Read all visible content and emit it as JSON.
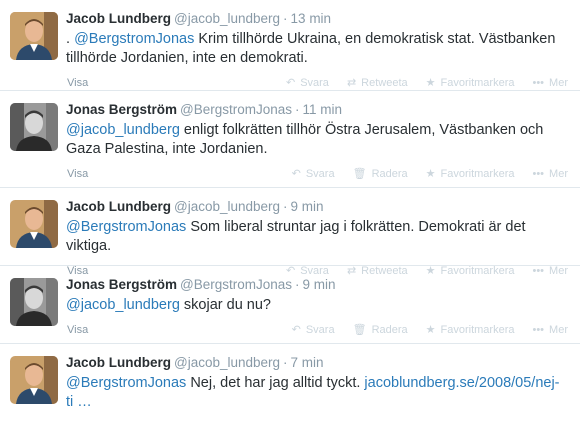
{
  "tweets": [
    {
      "avatar": "avatar-jacob",
      "fullname": "Jacob Lundberg",
      "username": "@jacob_lundberg",
      "separator": "·",
      "time": "13 min",
      "prefix": ". ",
      "mention": "@BergstromJonas",
      "text": " Krim tillhörde Ukraina, en demokratisk stat. Västbanken tillhörde Jordanien, inte en demokrati.",
      "expand": "Visa",
      "actions": [
        {
          "icon": "reply-icon",
          "glyph": "↶",
          "label": "Svara"
        },
        {
          "icon": "retweet-icon",
          "glyph": "⇄",
          "label": "Retweeta"
        },
        {
          "icon": "star-icon",
          "glyph": "★",
          "label": "Favoritmarkera"
        },
        {
          "icon": "more-icon",
          "glyph": "•••",
          "label": "Mer"
        }
      ]
    },
    {
      "avatar": "avatar-jonas",
      "fullname": "Jonas Bergström",
      "username": "@BergstromJonas",
      "separator": "·",
      "time": "11 min",
      "prefix": "",
      "mention": "@jacob_lundberg",
      "text": " enligt folkrätten tillhör Östra Jerusalem, Västbanken och Gaza Palestina, inte Jordanien.",
      "expand": "Visa",
      "actions": [
        {
          "icon": "reply-icon",
          "glyph": "↶",
          "label": "Svara"
        },
        {
          "icon": "delete-icon",
          "glyph": "🗑",
          "label": "Radera"
        },
        {
          "icon": "star-icon",
          "glyph": "★",
          "label": "Favoritmarkera"
        },
        {
          "icon": "more-icon",
          "glyph": "•••",
          "label": "Mer"
        }
      ]
    },
    {
      "avatar": "avatar-jacob",
      "fullname": "Jacob Lundberg",
      "username": "@jacob_lundberg",
      "separator": "·",
      "time": "9 min",
      "prefix": "",
      "mention": "@BergstromJonas",
      "text": " Som liberal struntar jag i folkrätten. Demokrati är det viktiga.",
      "expand": "Visa",
      "actions": [
        {
          "icon": "reply-icon",
          "glyph": "↶",
          "label": "Svara"
        },
        {
          "icon": "retweet-icon",
          "glyph": "⇄",
          "label": "Retweeta"
        },
        {
          "icon": "star-icon",
          "glyph": "★",
          "label": "Favoritmarkera"
        },
        {
          "icon": "more-icon",
          "glyph": "•••",
          "label": "Mer"
        }
      ]
    },
    {
      "avatar": "avatar-jonas",
      "fullname": "Jonas Bergström",
      "username": "@BergstromJonas",
      "separator": "·",
      "time": "9 min",
      "prefix": "",
      "mention": "@jacob_lundberg",
      "text": " skojar du nu?",
      "expand": "Visa",
      "actions": [
        {
          "icon": "reply-icon",
          "glyph": "↶",
          "label": "Svara"
        },
        {
          "icon": "delete-icon",
          "glyph": "🗑",
          "label": "Radera"
        },
        {
          "icon": "star-icon",
          "glyph": "★",
          "label": "Favoritmarkera"
        },
        {
          "icon": "more-icon",
          "glyph": "•••",
          "label": "Mer"
        }
      ]
    },
    {
      "avatar": "avatar-jacob",
      "fullname": "Jacob Lundberg",
      "username": "@jacob_lundberg",
      "separator": "·",
      "time": "7 min",
      "prefix": "",
      "mention": "@BergstromJonas",
      "text": " Nej, det har jag alltid tyckt. ",
      "link": "jacoblundberg.se/2008/05/nej-ti …",
      "expand": "",
      "actions": []
    }
  ],
  "colors": {
    "link": "#2b7bb9",
    "meta": "#8899a6",
    "text": "#292f33",
    "action": "#ccd6dd",
    "divider": "#e1e8ed"
  }
}
